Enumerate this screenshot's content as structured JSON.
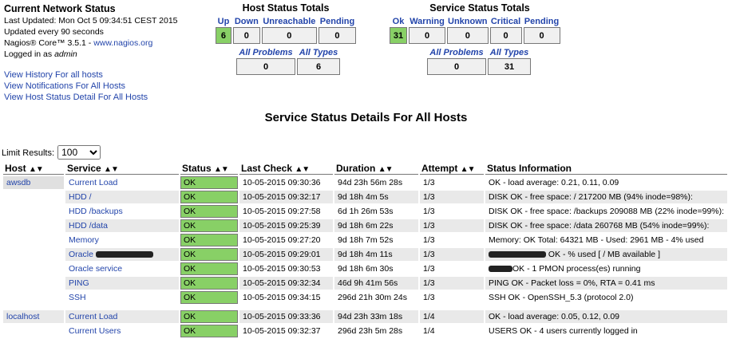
{
  "network": {
    "title": "Current Network Status",
    "last_updated": "Last Updated: Mon Oct 5 09:34:51 CEST 2015",
    "update_interval": "Updated every 90 seconds",
    "version_prefix": "Nagios® Core™ 3.5.1 - ",
    "version_link": "www.nagios.org",
    "logged_in_prefix": "Logged in as ",
    "user": "admin",
    "links": [
      "View History For all hosts",
      "View Notifications For All Hosts",
      "View Host Status Detail For All Hosts"
    ]
  },
  "host_totals": {
    "title": "Host Status Totals",
    "headers": [
      "Up",
      "Down",
      "Unreachable",
      "Pending"
    ],
    "values": [
      "6",
      "0",
      "0",
      "0"
    ],
    "sub_headers": [
      "All Problems",
      "All Types"
    ],
    "sub_values": [
      "0",
      "6"
    ]
  },
  "service_totals": {
    "title": "Service Status Totals",
    "headers": [
      "Ok",
      "Warning",
      "Unknown",
      "Critical",
      "Pending"
    ],
    "values": [
      "31",
      "0",
      "0",
      "0",
      "0"
    ],
    "sub_headers": [
      "All Problems",
      "All Types"
    ],
    "sub_values": [
      "0",
      "31"
    ]
  },
  "details_title": "Service Status Details For All Hosts",
  "limit": {
    "label": "Limit Results:",
    "value": "100"
  },
  "columns": [
    "Host",
    "Service",
    "Status",
    "Last Check",
    "Duration",
    "Attempt",
    "Status Information"
  ],
  "rows": [
    {
      "host": "awsdb",
      "service": "Current Load",
      "status": "OK",
      "last_check": "10-05-2015 09:30:36",
      "duration": "94d 23h 56m 28s",
      "attempt": "1/3",
      "info": "OK - load average: 0.21, 0.11, 0.09"
    },
    {
      "host": "",
      "service": "HDD /",
      "status": "OK",
      "last_check": "10-05-2015 09:32:17",
      "duration": "9d 18h 4m 5s",
      "attempt": "1/3",
      "info": "DISK OK - free space: / 217200 MB (94% inode=98%):"
    },
    {
      "host": "",
      "service": "HDD /backups",
      "status": "OK",
      "last_check": "10-05-2015 09:27:58",
      "duration": "6d 1h 26m 53s",
      "attempt": "1/3",
      "info": "DISK OK - free space: /backups 209088 MB (22% inode=99%):"
    },
    {
      "host": "",
      "service": "HDD /data",
      "status": "OK",
      "last_check": "10-05-2015 09:25:39",
      "duration": "9d 18h 6m 22s",
      "attempt": "1/3",
      "info": "DISK OK - free space: /data 260768 MB (54% inode=99%):"
    },
    {
      "host": "",
      "service": "Memory",
      "status": "OK",
      "last_check": "10-05-2015 09:27:20",
      "duration": "9d 18h 7m 52s",
      "attempt": "1/3",
      "info": "Memory: OK Total: 64321 MB - Used: 2961 MB - 4% used"
    },
    {
      "host": "",
      "service": "Oracle",
      "status": "OK",
      "last_check": "10-05-2015 09:29:01",
      "duration": "9d 18h 4m 11s",
      "attempt": "1/3",
      "info": "OK - % used [ / MB available ]"
    },
    {
      "host": "",
      "service": "Oracle service",
      "status": "OK",
      "last_check": "10-05-2015 09:30:53",
      "duration": "9d 18h 6m 30s",
      "attempt": "1/3",
      "info": "OK - 1 PMON process(es) running"
    },
    {
      "host": "",
      "service": "PING",
      "status": "OK",
      "last_check": "10-05-2015 09:32:34",
      "duration": "46d 9h 41m 56s",
      "attempt": "1/3",
      "info": "PING OK - Packet loss = 0%, RTA = 0.41 ms"
    },
    {
      "host": "",
      "service": "SSH",
      "status": "OK",
      "last_check": "10-05-2015 09:34:15",
      "duration": "296d 21h 30m 24s",
      "attempt": "1/3",
      "info": "SSH OK - OpenSSH_5.3 (protocol 2.0)"
    },
    {
      "host": "localhost",
      "service": "Current Load",
      "status": "OK",
      "last_check": "10-05-2015 09:33:36",
      "duration": "94d 23h 33m 18s",
      "attempt": "1/4",
      "info": "OK - load average: 0.05, 0.12, 0.09"
    },
    {
      "host": "",
      "service": "Current Users",
      "status": "OK",
      "last_check": "10-05-2015 09:32:37",
      "duration": "296d 23h 5m 28s",
      "attempt": "1/4",
      "info": "USERS OK - 4 users currently logged in"
    }
  ],
  "colors": {
    "ok": "#88d066",
    "link": "#2244aa",
    "alt_row": "#e9e9e9"
  }
}
